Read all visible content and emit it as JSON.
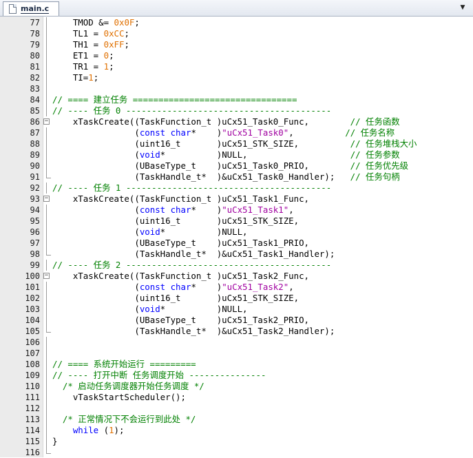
{
  "tab": {
    "label": "main.c"
  },
  "lines": [
    {
      "n": "77",
      "segs": [
        [
          "t",
          "    TMOD &= "
        ],
        [
          "n",
          "0x0F"
        ],
        [
          "t",
          ";"
        ]
      ]
    },
    {
      "n": "78",
      "segs": [
        [
          "t",
          "    TL1 = "
        ],
        [
          "n",
          "0xCC"
        ],
        [
          "t",
          ";"
        ]
      ]
    },
    {
      "n": "79",
      "segs": [
        [
          "t",
          "    TH1 = "
        ],
        [
          "n",
          "0xFF"
        ],
        [
          "t",
          ";"
        ]
      ]
    },
    {
      "n": "80",
      "segs": [
        [
          "t",
          "    ET1 = "
        ],
        [
          "n",
          "0"
        ],
        [
          "t",
          ";"
        ]
      ]
    },
    {
      "n": "81",
      "segs": [
        [
          "t",
          "    TR1 = "
        ],
        [
          "n",
          "1"
        ],
        [
          "t",
          ";"
        ]
      ]
    },
    {
      "n": "82",
      "segs": [
        [
          "t",
          "    TI="
        ],
        [
          "n",
          "1"
        ],
        [
          "t",
          ";"
        ]
      ]
    },
    {
      "n": "83",
      "segs": []
    },
    {
      "n": "84",
      "segs": [
        [
          "c",
          "// ==== 建立任务 ================================"
        ]
      ]
    },
    {
      "n": "85",
      "segs": [
        [
          "c",
          "// ---- 任务 0 ----------------------------------------"
        ]
      ]
    },
    {
      "n": "86",
      "fold": "open",
      "segs": [
        [
          "t",
          "    xTaskCreate((TaskFunction_t )uCx51_Task0_Func,        "
        ],
        [
          "c",
          "// 任务函数"
        ]
      ]
    },
    {
      "n": "87",
      "fold": "line",
      "segs": [
        [
          "t",
          "                ("
        ],
        [
          "k",
          "const char"
        ],
        [
          "t",
          "*    )"
        ],
        [
          "s",
          "\"uCx51_Task0\""
        ],
        [
          "t",
          ",          "
        ],
        [
          "c",
          "// 任务名称"
        ]
      ]
    },
    {
      "n": "88",
      "fold": "line",
      "segs": [
        [
          "t",
          "                (uint16_t       )uCx51_STK_SIZE,          "
        ],
        [
          "c",
          "// 任务堆栈大小"
        ]
      ]
    },
    {
      "n": "89",
      "fold": "line",
      "segs": [
        [
          "t",
          "                ("
        ],
        [
          "k",
          "void"
        ],
        [
          "t",
          "*          )NULL,                    "
        ],
        [
          "c",
          "// 任务参数"
        ]
      ]
    },
    {
      "n": "90",
      "fold": "line",
      "segs": [
        [
          "t",
          "                (UBaseType_t    )uCx51_Task0_PRIO,        "
        ],
        [
          "c",
          "// 任务优先级"
        ]
      ]
    },
    {
      "n": "91",
      "fold": "end",
      "segs": [
        [
          "t",
          "                (TaskHandle_t*  )&uCx51_Task0_Handler);   "
        ],
        [
          "c",
          "// 任务句柄"
        ]
      ]
    },
    {
      "n": "92",
      "segs": [
        [
          "c",
          "// ---- 任务 1 ----------------------------------------"
        ]
      ]
    },
    {
      "n": "93",
      "fold": "open",
      "segs": [
        [
          "t",
          "    xTaskCreate((TaskFunction_t )uCx51_Task1_Func,"
        ]
      ]
    },
    {
      "n": "94",
      "fold": "line",
      "segs": [
        [
          "t",
          "                ("
        ],
        [
          "k",
          "const char"
        ],
        [
          "t",
          "*    )"
        ],
        [
          "s",
          "\"uCx51_Task1\""
        ],
        [
          "t",
          ","
        ]
      ]
    },
    {
      "n": "95",
      "fold": "line",
      "segs": [
        [
          "t",
          "                (uint16_t       )uCx51_STK_SIZE,"
        ]
      ]
    },
    {
      "n": "96",
      "fold": "line",
      "segs": [
        [
          "t",
          "                ("
        ],
        [
          "k",
          "void"
        ],
        [
          "t",
          "*          )NULL,"
        ]
      ]
    },
    {
      "n": "97",
      "fold": "line",
      "segs": [
        [
          "t",
          "                (UBaseType_t    )uCx51_Task1_PRIO,"
        ]
      ]
    },
    {
      "n": "98",
      "fold": "end",
      "segs": [
        [
          "t",
          "                (TaskHandle_t*  )&uCx51_Task1_Handler);"
        ]
      ]
    },
    {
      "n": "99",
      "segs": [
        [
          "c",
          "// ---- 任务 2 ----------------------------------------"
        ]
      ]
    },
    {
      "n": "100",
      "fold": "open",
      "segs": [
        [
          "t",
          "    xTaskCreate((TaskFunction_t )uCx51_Task2_Func,"
        ]
      ]
    },
    {
      "n": "101",
      "fold": "line",
      "segs": [
        [
          "t",
          "                ("
        ],
        [
          "k",
          "const char"
        ],
        [
          "t",
          "*    )"
        ],
        [
          "s",
          "\"uCx51_Task2\""
        ],
        [
          "t",
          ","
        ]
      ]
    },
    {
      "n": "102",
      "fold": "line",
      "segs": [
        [
          "t",
          "                (uint16_t       )uCx51_STK_SIZE,"
        ]
      ]
    },
    {
      "n": "103",
      "fold": "line",
      "segs": [
        [
          "t",
          "                ("
        ],
        [
          "k",
          "void"
        ],
        [
          "t",
          "*          )NULL,"
        ]
      ]
    },
    {
      "n": "104",
      "fold": "line",
      "segs": [
        [
          "t",
          "                (UBaseType_t    )uCx51_Task2_PRIO,"
        ]
      ]
    },
    {
      "n": "105",
      "fold": "end",
      "segs": [
        [
          "t",
          "                (TaskHandle_t*  )&uCx51_Task2_Handler);"
        ]
      ]
    },
    {
      "n": "106",
      "segs": []
    },
    {
      "n": "107",
      "segs": []
    },
    {
      "n": "108",
      "segs": [
        [
          "c",
          "// ==== 系统开始运行 ========="
        ]
      ]
    },
    {
      "n": "109",
      "segs": [
        [
          "c",
          "// ---- 打开中断 任务调度开始 ---------------"
        ]
      ]
    },
    {
      "n": "110",
      "segs": [
        [
          "c",
          "  /* 启动任务调度器开始任务调度 */"
        ]
      ]
    },
    {
      "n": "111",
      "segs": [
        [
          "t",
          "    vTaskStartScheduler();"
        ]
      ]
    },
    {
      "n": "112",
      "segs": []
    },
    {
      "n": "113",
      "segs": [
        [
          "c",
          "  /* 正常情况下不会运行到此处 */"
        ]
      ]
    },
    {
      "n": "114",
      "segs": [
        [
          "t",
          "    "
        ],
        [
          "k",
          "while"
        ],
        [
          "t",
          " ("
        ],
        [
          "n",
          "1"
        ],
        [
          "t",
          ");"
        ]
      ]
    },
    {
      "n": "115",
      "fold": "close",
      "segs": [
        [
          "t",
          "}"
        ]
      ]
    },
    {
      "n": "116",
      "fold": "tail",
      "segs": []
    }
  ]
}
